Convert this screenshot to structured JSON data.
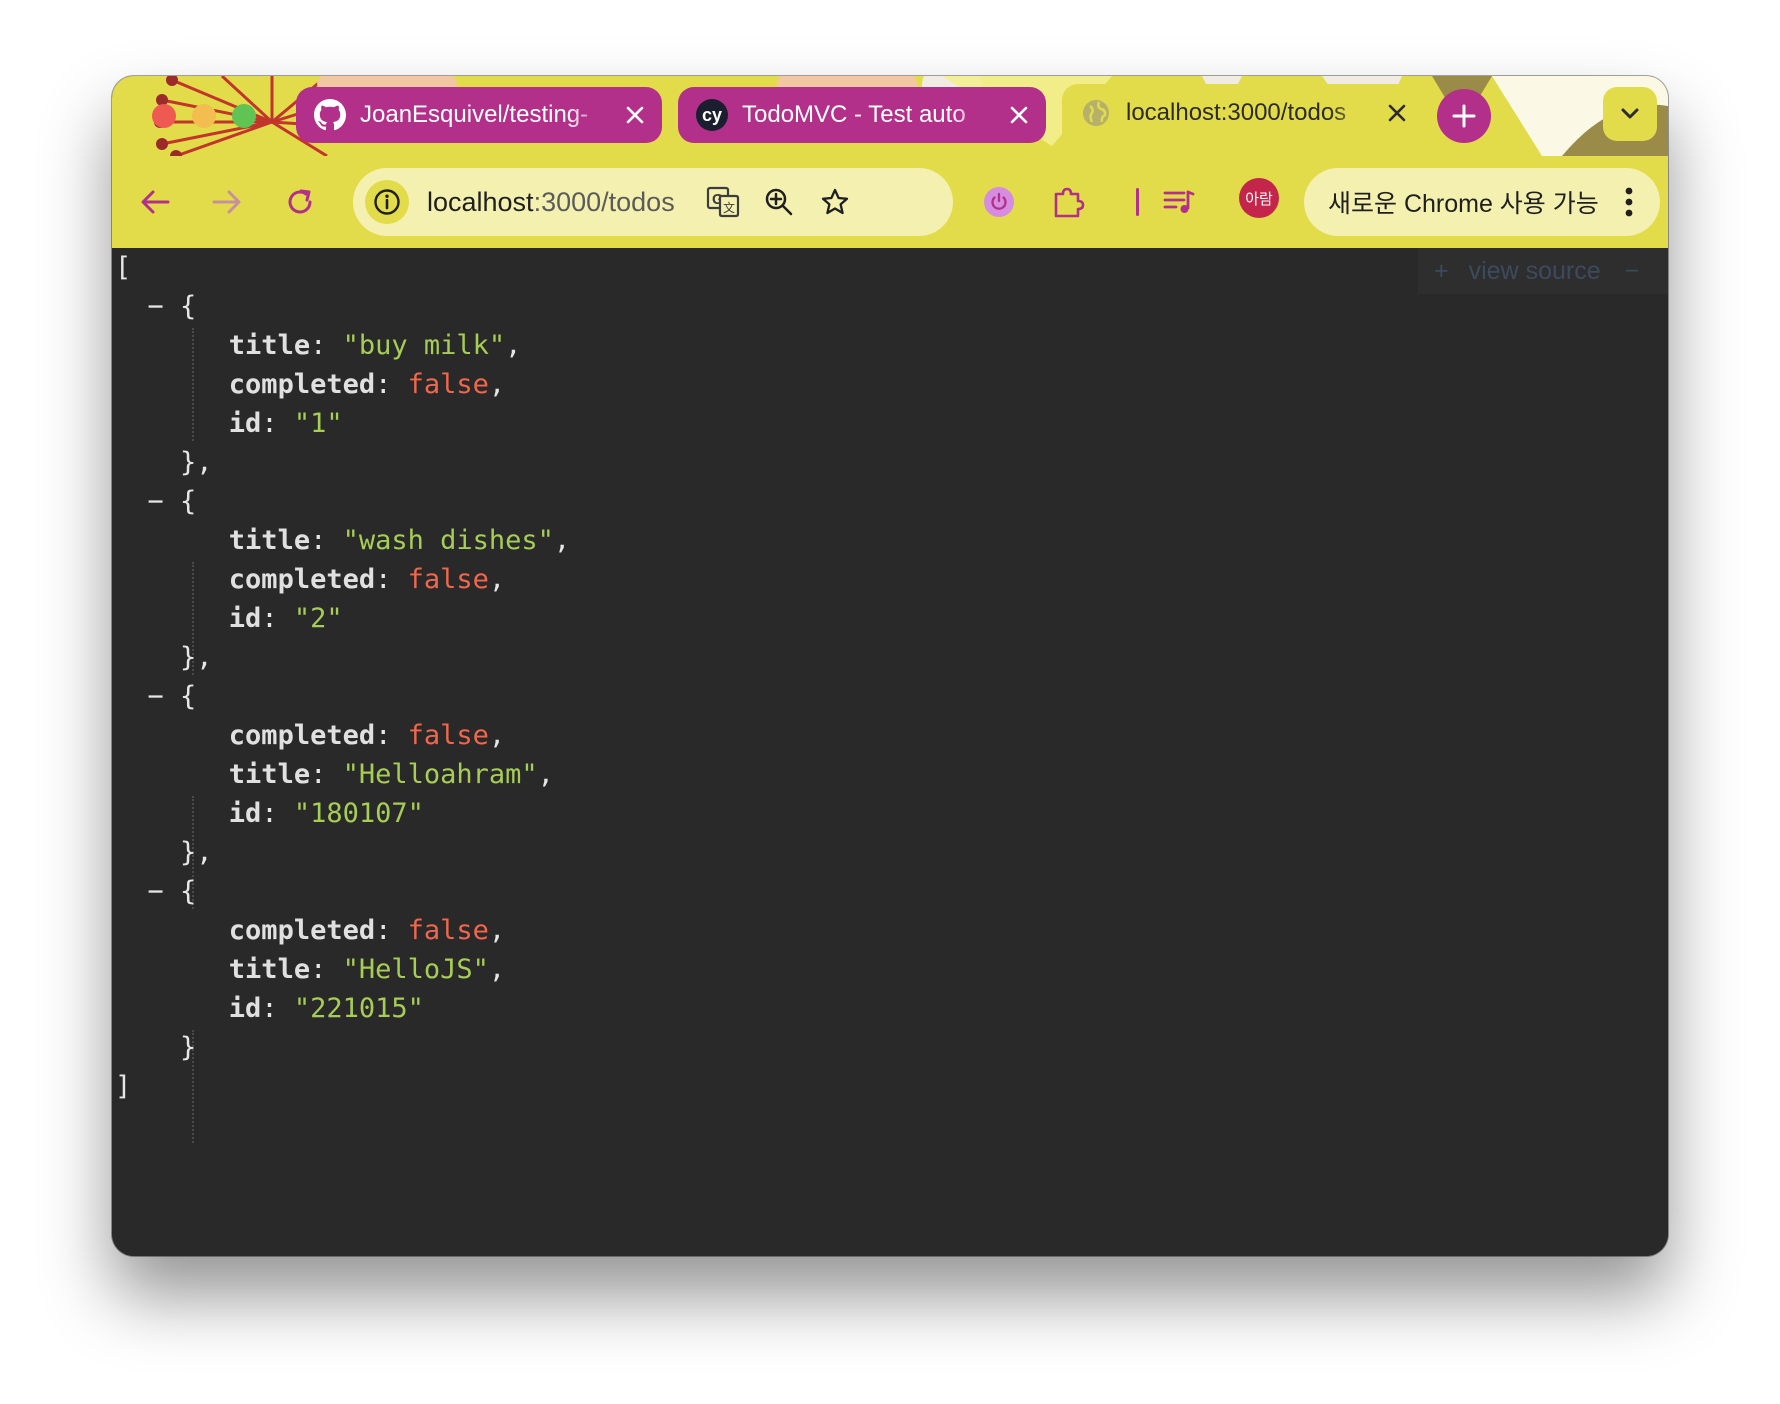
{
  "tabs": [
    {
      "title": "JoanEsquivel/testing-",
      "favicon": "github-icon",
      "active": false
    },
    {
      "title": "TodoMVC - Test auto",
      "favicon": "cypress-icon",
      "favicon_text": "cy",
      "active": false
    },
    {
      "title": "localhost:3000/todos",
      "favicon": "globe-icon",
      "active": true
    }
  ],
  "toolbar": {
    "url_host": "localhost",
    "url_path": ":3000/todos",
    "profile_label": "아람",
    "update_label": "새로운 Chrome 사용 가능"
  },
  "viewer": {
    "view_source_label": "view source",
    "expand_symbol": "+",
    "collapse_symbol": "−"
  },
  "colors": {
    "theme": "#e2dc4b",
    "tab_inactive": "#b3308a",
    "json_string": "#a6cd55",
    "json_boolean": "#f0674d",
    "page_background": "#292929"
  },
  "todos": [
    {
      "fields": [
        {
          "key": "title",
          "value": "\"buy milk\"",
          "type": "string"
        },
        {
          "key": "completed",
          "value": "false",
          "type": "boolean"
        },
        {
          "key": "id",
          "value": "\"1\"",
          "type": "string"
        }
      ]
    },
    {
      "fields": [
        {
          "key": "title",
          "value": "\"wash dishes\"",
          "type": "string"
        },
        {
          "key": "completed",
          "value": "false",
          "type": "boolean"
        },
        {
          "key": "id",
          "value": "\"2\"",
          "type": "string"
        }
      ]
    },
    {
      "fields": [
        {
          "key": "completed",
          "value": "false",
          "type": "boolean"
        },
        {
          "key": "title",
          "value": "\"Helloahram\"",
          "type": "string"
        },
        {
          "key": "id",
          "value": "\"180107\"",
          "type": "string"
        }
      ]
    },
    {
      "fields": [
        {
          "key": "completed",
          "value": "false",
          "type": "boolean"
        },
        {
          "key": "title",
          "value": "\"HelloJS\"",
          "type": "string"
        },
        {
          "key": "id",
          "value": "\"221015\"",
          "type": "string"
        }
      ]
    }
  ]
}
